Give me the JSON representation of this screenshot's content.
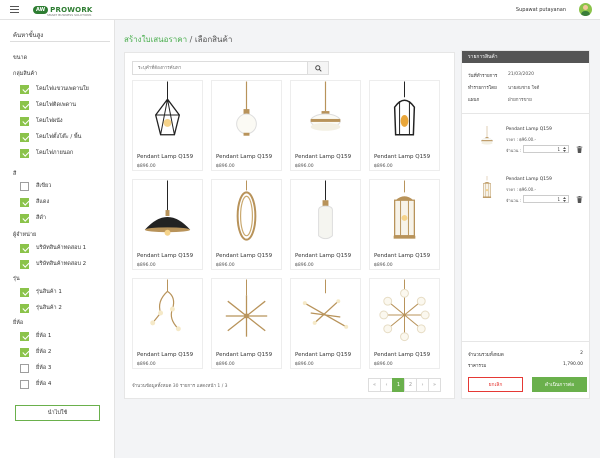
{
  "header": {
    "logo_badge": "AW",
    "logo_text": "PROWORK",
    "logo_sub": "SMART BUSINESS SOLUTIONS",
    "user_name": "Supawat putayanan"
  },
  "sidebar": {
    "title": "ค้นหาขั้นสูง",
    "size_label": "ขนาด",
    "group_category": "กลุ่มสินค้า",
    "categories": [
      {
        "label": "โคมไฟแขวนเพดานใย",
        "checked": true
      },
      {
        "label": "โคมไฟติดเพดาน",
        "checked": true
      },
      {
        "label": "โคมไฟผนัง",
        "checked": true
      },
      {
        "label": "โคมไฟตั้งโต๊ะ / พื้น",
        "checked": true
      },
      {
        "label": "โคมไฟภายนอก",
        "checked": true
      }
    ],
    "group_color": "สี",
    "colors": [
      {
        "label": "สีเขียว",
        "checked": false
      },
      {
        "label": "สีแดง",
        "checked": true
      },
      {
        "label": "สีดำ",
        "checked": true
      }
    ],
    "group_vendor": "ผู้จำหน่าย",
    "vendors": [
      {
        "label": "บริษัทสินค้าทดสอบ 1",
        "checked": true
      },
      {
        "label": "บริษัทสินค้าทดสอบ 2",
        "checked": true
      }
    ],
    "group_model": "รุ่น",
    "models": [
      {
        "label": "รุ่นสินค้า 1",
        "checked": true
      },
      {
        "label": "รุ่นสินค้า 2",
        "checked": true
      }
    ],
    "group_brand": "ยี่ห้อ",
    "brands": [
      {
        "label": "ยี่ห้อ 1",
        "checked": true
      },
      {
        "label": "ยี่ห้อ 2",
        "checked": true
      },
      {
        "label": "ยี่ห้อ 3",
        "checked": false
      },
      {
        "label": "ยี่ห้อ 4",
        "checked": false
      }
    ],
    "apply_label": "นำไปใช้"
  },
  "breadcrumb": {
    "link": "สร้างใบเสนอราคา",
    "sep": " / ",
    "current": "เลือกสินค้า"
  },
  "search": {
    "placeholder": "ระบุคำที่ต้องการค้นหา"
  },
  "products": [
    {
      "name": "Pendant Lamp Q159",
      "price": "฿896.00",
      "icon": "geometric-cage-lamp"
    },
    {
      "name": "Pendant Lamp Q159",
      "price": "฿896.00",
      "icon": "globe-pendant-lamp"
    },
    {
      "name": "Pendant Lamp Q159",
      "price": "฿896.00",
      "icon": "drum-pendant-lamp"
    },
    {
      "name": "Pendant Lamp Q159",
      "price": "฿896.00",
      "icon": "wire-cage-lamp"
    },
    {
      "name": "Pendant Lamp Q159",
      "price": "฿896.00",
      "icon": "dome-pendant-lamp"
    },
    {
      "name": "Pendant Lamp Q159",
      "price": "฿896.00",
      "icon": "ring-loop-lamp"
    },
    {
      "name": "Pendant Lamp Q159",
      "price": "฿896.00",
      "icon": "glass-bottle-lamp"
    },
    {
      "name": "Pendant Lamp Q159",
      "price": "฿896.00",
      "icon": "lantern-lamp"
    },
    {
      "name": "Pendant Lamp Q159",
      "price": "฿896.00",
      "icon": "branch-chandelier"
    },
    {
      "name": "Pendant Lamp Q159",
      "price": "฿896.00",
      "icon": "sputnik-chandelier"
    },
    {
      "name": "Pendant Lamp Q159",
      "price": "฿896.00",
      "icon": "linear-branch-chandelier"
    },
    {
      "name": "Pendant Lamp Q159",
      "price": "฿896.00",
      "icon": "globe-cluster-chandelier"
    }
  ],
  "pagination": {
    "info": "จำนวนข้อมูลทั้งหมด 30 รายการ แสดงหน้า 1 / 3",
    "prev_first": "«",
    "prev": "‹",
    "pages": [
      "1",
      "2"
    ],
    "next": "›",
    "next_last": "»"
  },
  "cart": {
    "title": "รายการสินค้า",
    "date_label": "วันที่ทำรายการ",
    "date_value": "21/03/2020",
    "maker_label": "ทำรายการโดย",
    "maker_value": "นายสมชาย ใจดี",
    "dept_label": "แผนก",
    "dept_value": "ฝ่ายการขาย",
    "items": [
      {
        "name": "Pendant Lamp Q159",
        "price": "ราคา : ฿96.00.-",
        "qty_label": "จำนวน :",
        "qty": "1",
        "icon": "drum-pendant-lamp"
      },
      {
        "name": "Pendant Lamp Q159",
        "price": "ราคา : ฿96.00.-",
        "qty_label": "จำนวน :",
        "qty": "1",
        "icon": "lantern-lamp"
      }
    ],
    "total_qty_label": "จำนวนรวมทั้งหมด",
    "total_qty_value": "2",
    "total_price_label": "ราคารวม",
    "total_price_value": "1,790.00",
    "cancel_label": "ยกเลิก",
    "continue_label": "ดำเนินการต่อ"
  },
  "colors": {
    "accent": "#6ab04c",
    "cancel": "#e53935",
    "cart_header": "#555555"
  }
}
